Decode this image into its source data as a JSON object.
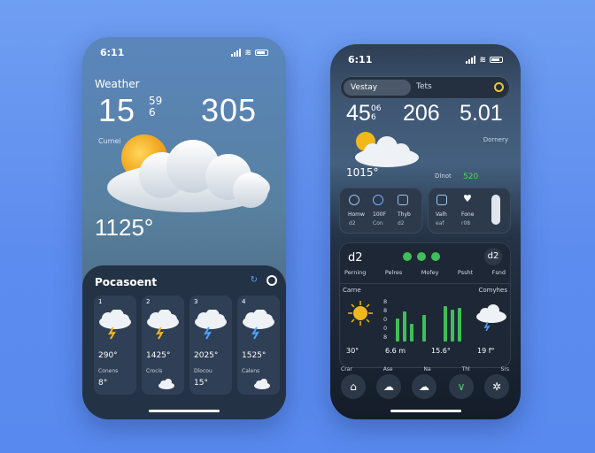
{
  "left": {
    "time": "6:11",
    "title": "Weather",
    "temp1": "15",
    "temp1_sup": "59",
    "temp1_sub": "6",
    "temp2": "305",
    "condition": "Cumei",
    "big_temp": "1125°",
    "forecast": {
      "title": "Pocasoent",
      "cards": [
        {
          "day": "1",
          "temp": "290°",
          "label": "Conens",
          "value": "8°"
        },
        {
          "day": "2",
          "temp": "1425°",
          "label": "Crocis",
          "value": ""
        },
        {
          "day": "3",
          "temp": "2025°",
          "label": "Dlocou",
          "value": "15°"
        },
        {
          "day": "4",
          "temp": "1525°",
          "label": "Calens",
          "value": ""
        }
      ]
    }
  },
  "right": {
    "time": "6:11",
    "tab_active": "Vestay",
    "tab_other": "Tets",
    "n1": "45",
    "n1_sup": "06",
    "n1_sub": "6",
    "n2": "206",
    "n3": "5.01",
    "condition": "Dornery",
    "small_temp": "1015°",
    "small_right_1": "Dlnot",
    "small_right_2": "520",
    "tiles": [
      {
        "l1": "Homw",
        "l2": "d2"
      },
      {
        "l1": "100F",
        "l2": "Con"
      },
      {
        "l1": "Thyb",
        "l2": "d2"
      },
      {
        "l1": "Valh",
        "l2": "eaf"
      },
      {
        "l1": "Fone",
        "l2": "r08"
      }
    ],
    "card": {
      "value": "d2",
      "labels": [
        "Perning",
        "Pelres",
        "Mofey",
        "Pssht",
        "Fsnd"
      ],
      "left_label": "Carne",
      "right_label": "Comyhes",
      "axis": [
        "8",
        "8",
        "0",
        "0",
        "8"
      ],
      "stat1": "30°",
      "stat2": "6.6 m",
      "stat3": "15.6°",
      "stat4": "19 f°"
    },
    "nav_labels": [
      "Crar",
      "Ase",
      "Na",
      "Thl",
      "Srs"
    ],
    "colors": {
      "accent": "#52d36a",
      "sun": "#f1b81c"
    }
  }
}
